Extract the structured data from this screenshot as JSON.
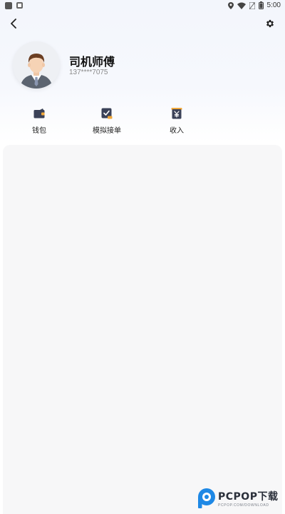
{
  "status_bar": {
    "time": "5:00",
    "icons": [
      "notification-square-icon",
      "sim-card-icon",
      "location-icon",
      "wifi-icon",
      "no-sim-icon",
      "battery-icon"
    ]
  },
  "header": {
    "back_icon": "chevron-left-icon",
    "settings_icon": "gear-icon"
  },
  "profile": {
    "name": "司机师傅",
    "phone": "137****7075",
    "avatar": "male-driver-avatar"
  },
  "actions": [
    {
      "label": "钱包",
      "icon": "wallet-icon"
    },
    {
      "label": "模拟接单",
      "icon": "task-check-icon"
    },
    {
      "label": "收入",
      "icon": "income-yen-icon"
    }
  ],
  "watermark": {
    "text": "PCPOP下载",
    "sub": "PCPOP.COM/DOWNLOAD"
  },
  "colors": {
    "icon_dark": "#3b4258",
    "icon_accent": "#f2a93b",
    "panel_bg": "#f7f7f8",
    "header_bg": "#f3f6fc",
    "watermark_blue": "#1e88e5"
  }
}
